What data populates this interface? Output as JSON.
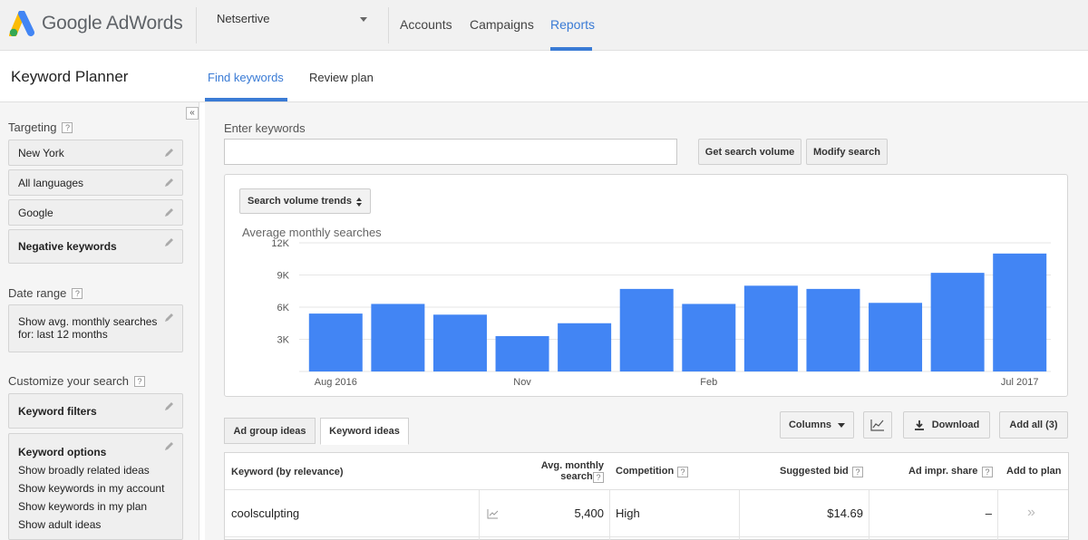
{
  "app": {
    "logo_text": "Google AdWords",
    "account": "Netsertive",
    "nav": [
      "Accounts",
      "Campaigns",
      "Reports"
    ],
    "nav_active": "Reports",
    "accent_color": "#3a7bd5"
  },
  "planner": {
    "title": "Keyword Planner",
    "tabs": [
      "Find keywords",
      "Review plan"
    ],
    "active_tab": "Find keywords"
  },
  "sidebar": {
    "targeting_label": "Targeting",
    "targeting_items": [
      "New York",
      "All languages",
      "Google",
      "Negative keywords"
    ],
    "date_range_label": "Date range",
    "date_range_value_line1": "Show avg. monthly searches",
    "date_range_value_line2": "for: last 12 months",
    "customize_label": "Customize your search",
    "keyword_filters": "Keyword filters",
    "keyword_options_title": "Keyword options",
    "keyword_options": [
      "Show broadly related ideas",
      "Show keywords in my account",
      "Show keywords in my plan",
      "Show adult ideas"
    ],
    "help_glyph": "?",
    "collapse_glyph": "«"
  },
  "search": {
    "label": "Enter keywords",
    "value": "",
    "get_volume_btn": "Get search volume",
    "modify_btn": "Modify search"
  },
  "trend_select": "Search volume trends",
  "chart_data": {
    "type": "bar",
    "title": "Average monthly searches",
    "categories": [
      "Aug 2016",
      "Sep 2016",
      "Oct 2016",
      "Nov 2016",
      "Dec 2016",
      "Jan 2017",
      "Feb 2017",
      "Mar 2017",
      "Apr 2017",
      "May 2017",
      "Jun 2017",
      "Jul 2017"
    ],
    "values": [
      5400,
      6300,
      5300,
      3300,
      4500,
      7700,
      6300,
      8000,
      7700,
      6400,
      9200,
      11000
    ],
    "tick_labels": [
      "Aug 2016",
      "Nov",
      "Feb",
      "Jul 2017"
    ],
    "tick_indices": [
      0,
      3,
      6,
      11
    ],
    "y_ticks": [
      "3K",
      "6K",
      "9K",
      "12K"
    ],
    "y_tick_values": [
      3000,
      6000,
      9000,
      12000
    ],
    "ylim": [
      0,
      12000
    ],
    "bar_color": "#4285f4",
    "grid": true
  },
  "idea_tabs": [
    "Ad group ideas",
    "Keyword ideas"
  ],
  "idea_tab_active": "Keyword ideas",
  "toolbar": {
    "columns": "Columns",
    "download": "Download",
    "add_all": "Add all (3)"
  },
  "table": {
    "headers": {
      "keyword": "Keyword (by relevance)",
      "avg": "Avg. monthly searches",
      "competition": "Competition",
      "bid": "Suggested bid",
      "impr": "Ad impr. share",
      "add": "Add to plan"
    },
    "rows": [
      {
        "keyword": "coolsculpting",
        "avg": "5,400",
        "competition": "High",
        "bid": "$14.69",
        "impr": "–",
        "add": "»"
      }
    ]
  }
}
